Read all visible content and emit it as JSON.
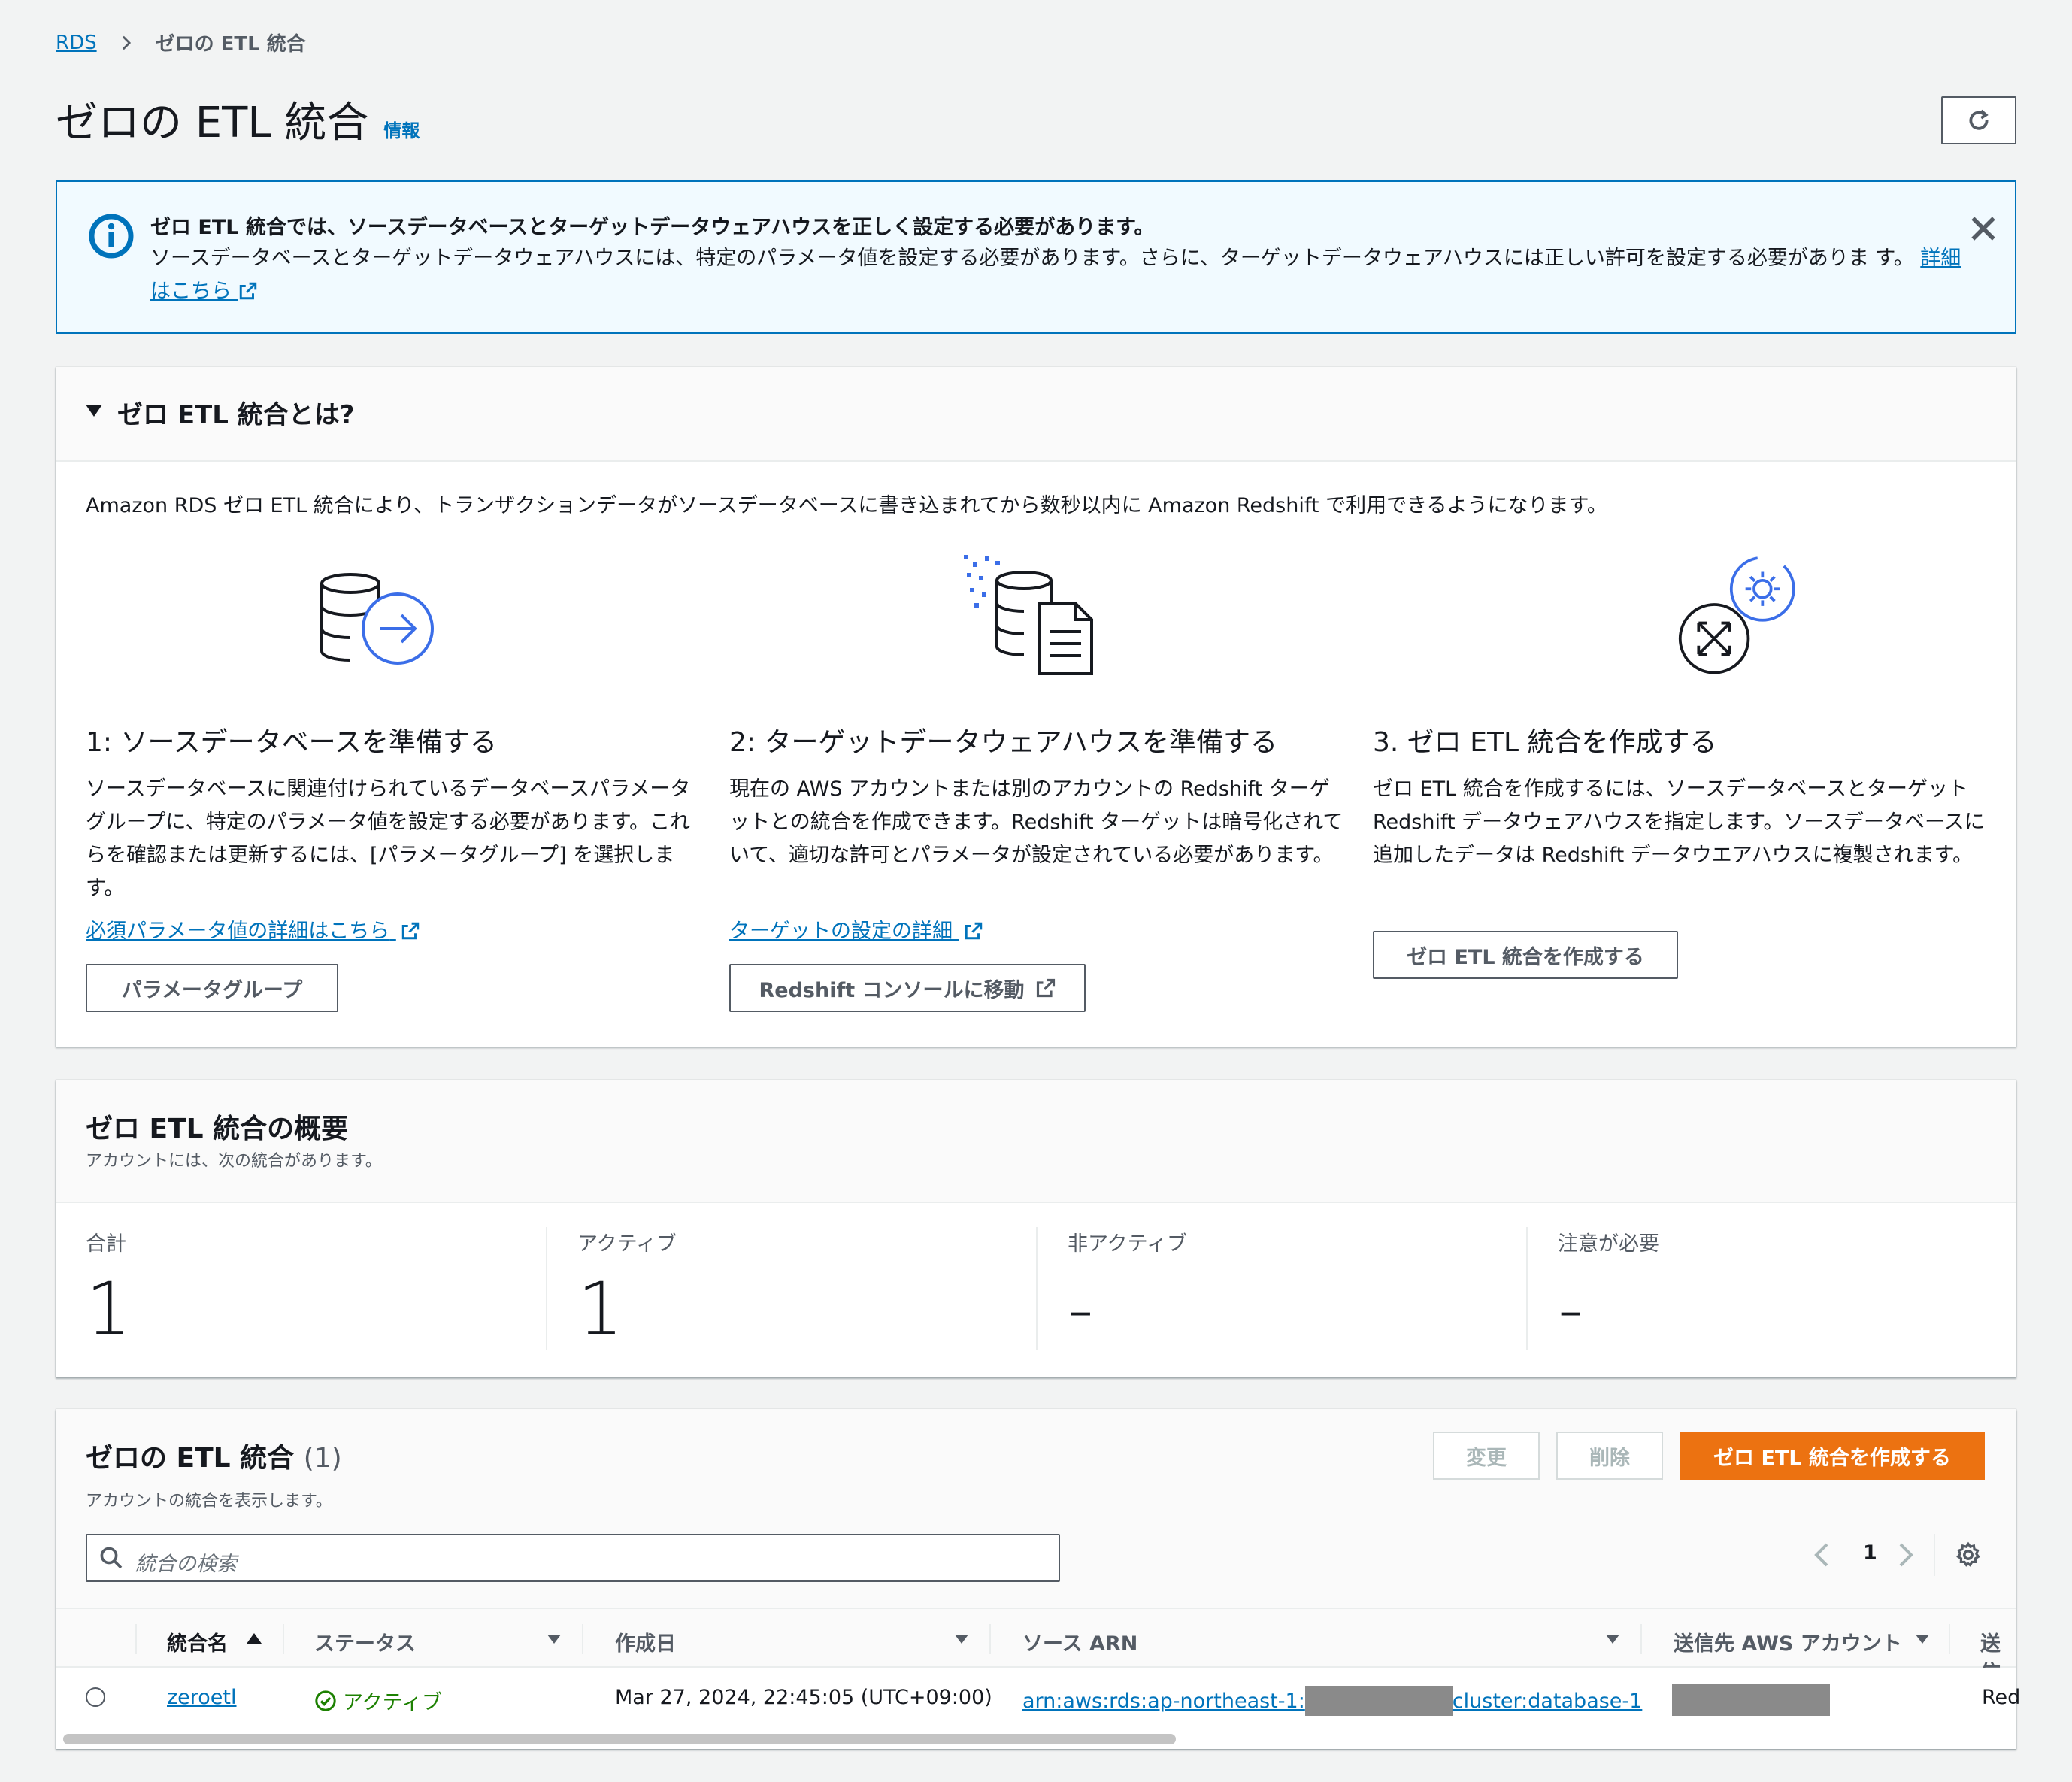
{
  "breadcrumb": {
    "root": "RDS",
    "current": "ゼロの ETL 統合"
  },
  "page": {
    "title": "ゼロの ETL 統合",
    "info": "情報"
  },
  "alert": {
    "title": "ゼロ ETL 統合では、ソースデータベースとターゲットデータウェアハウスを正しく設定する必要があります。",
    "body": "ソースデータベースとターゲットデータウェアハウスには、特定のパラメータ値を設定する必要があります。さらに、ターゲットデータウェアハウスには正しい許可を設定する必要がありま す。",
    "link": "詳細はこちら"
  },
  "whatis": {
    "title": "ゼロ ETL 統合とは?",
    "intro": "Amazon RDS ゼロ ETL 統合により、トランザクションデータがソースデータベースに書き込まれてから数秒以内に Amazon Redshift で利用できるようになります。",
    "steps": [
      {
        "title": "1: ソースデータベースを準備する",
        "desc": "ソースデータベースに関連付けられているデータベースパラメータグループに、特定のパラメータ値を設定する必要があります。これらを確認または更新するには、[パラメータグループ] を選択します。",
        "link": "必須パラメータ値の詳細はこちら",
        "button": "パラメータグループ",
        "icon": "database-arrow-icon"
      },
      {
        "title": "2: ターゲットデータウェアハウスを準備する",
        "desc": "現在の AWS アカウントまたは別のアカウントの Redshift ターゲットとの統合を作成できます。Redshift ターゲットは暗号化されていて、適切な許可とパラメータが設定されている必要があります。",
        "link": "ターゲットの設定の詳細",
        "button": "Redshift コンソールに移動",
        "icon": "database-document-icon"
      },
      {
        "title": "3. ゼロ ETL 統合を作成する",
        "desc": "ゼロ ETL 統合を作成するには、ソースデータベースとターゲット Redshift データウェアハウスを指定します。ソースデータベースに追加したデータは Redshift データウエアハウスに複製されます。",
        "button": "ゼロ ETL 統合を作成する",
        "icon": "integration-gear-icon"
      }
    ]
  },
  "summary": {
    "title": "ゼロ ETL 統合の概要",
    "subtitle": "アカウントには、次の統合があります。",
    "metrics": [
      {
        "label": "合計",
        "value": "1"
      },
      {
        "label": "アクティブ",
        "value": "1"
      },
      {
        "label": "非アクティブ",
        "value": "-"
      },
      {
        "label": "注意が必要",
        "value": "-"
      }
    ]
  },
  "table": {
    "title": "ゼロの ETL 統合",
    "count": "(1)",
    "subtitle": "アカウントの統合を表示します。",
    "buttons": {
      "modify": "変更",
      "delete": "削除",
      "create": "ゼロ ETL 統合を作成する"
    },
    "search_placeholder": "統合の検索",
    "page": "1",
    "columns": [
      "統合名",
      "ステータス",
      "作成日",
      "ソース ARN",
      "送信先 AWS アカウント",
      "送信"
    ],
    "rows": [
      {
        "name": "zeroetl",
        "status": "アクティブ",
        "created": "Mar 27, 2024, 22:45:05 (UTC+09:00)",
        "arn_prefix": "arn:aws:rds:ap-northeast-1:",
        "arn_suffix": "cluster:database-1",
        "dest_partial": "Red"
      }
    ]
  },
  "colors": {
    "link": "#0073bb",
    "primary": "#ec7211",
    "success": "#1d8102",
    "info_bg": "#f1faff"
  }
}
